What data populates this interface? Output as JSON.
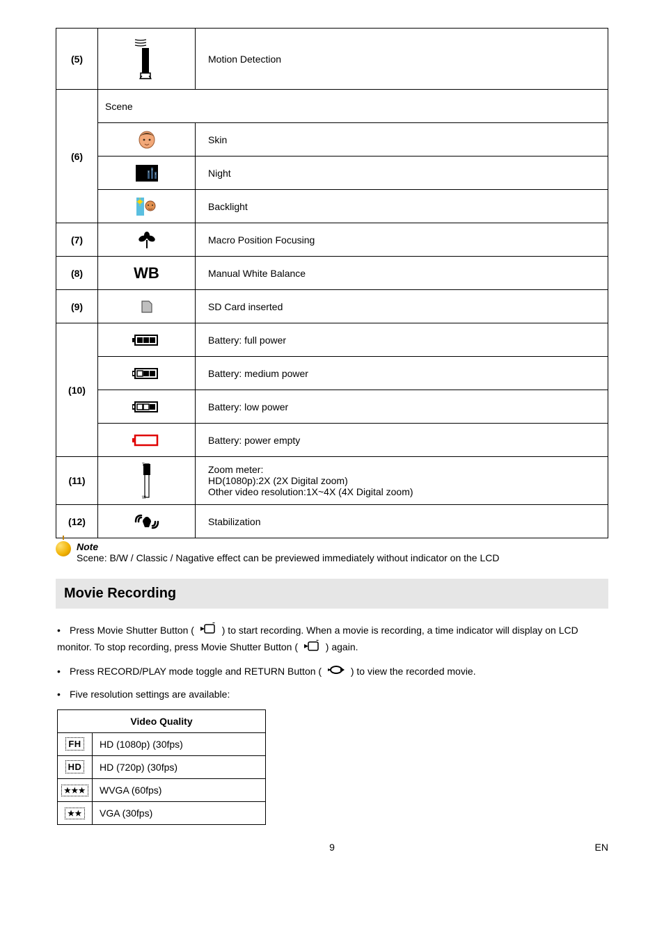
{
  "table_rows": {
    "r5": {
      "num": "(5)",
      "desc": "Motion Detection"
    },
    "r6": {
      "num": "(6)",
      "header": "Scene",
      "skin": "Skin",
      "night": "Night",
      "backlight": "Backlight"
    },
    "r7": {
      "num": "(7)",
      "desc": "Macro Position Focusing"
    },
    "r8": {
      "num": "(8)",
      "icon_text": "WB",
      "desc": "Manual White Balance"
    },
    "r9": {
      "num": "(9)",
      "desc": "SD Card inserted"
    },
    "r10": {
      "num": "(10)",
      "b_full": "Battery: full power",
      "b_med": "Battery: medium power",
      "b_low": "Battery: low power",
      "b_empty": "Battery: power empty"
    },
    "r11": {
      "num": "(11)",
      "l1": "Zoom meter:",
      "l2": "HD(1080p):2X (2X Digital zoom)",
      "l3": "Other video resolution:1X~4X (4X Digital zoom)"
    },
    "r12": {
      "num": "(12)",
      "desc": "Stabilization"
    }
  },
  "note": {
    "title": "Note",
    "body": "Scene: B/W / Classic / Nagative effect can be previewed immediately without indicator on the LCD"
  },
  "section_title": "Movie Recording",
  "bullets": {
    "b1a": "Press Movie Shutter Button ( ",
    "b1b": " ) to start recording. When a movie is recording, a time indicator will display on LCD monitor. To stop recording, press Movie Shutter Button ( ",
    "b1c": " ) again.",
    "b2a": "Press RECORD/PLAY mode toggle and RETURN Button ( ",
    "b2b": " ) to view the recorded movie.",
    "b3": "Five resolution settings are available:"
  },
  "vq": {
    "header": "Video Quality",
    "r1_icon": "FH",
    "r1": "HD (1080p) (30fps)",
    "r2_icon": "HD",
    "r2": "HD (720p) (30fps)",
    "r3_icon": "★★★",
    "r3": "WVGA (60fps)",
    "r4_icon": "★★",
    "r4": "VGA (30fps)"
  },
  "footer": {
    "page": "9",
    "lang": "EN"
  }
}
